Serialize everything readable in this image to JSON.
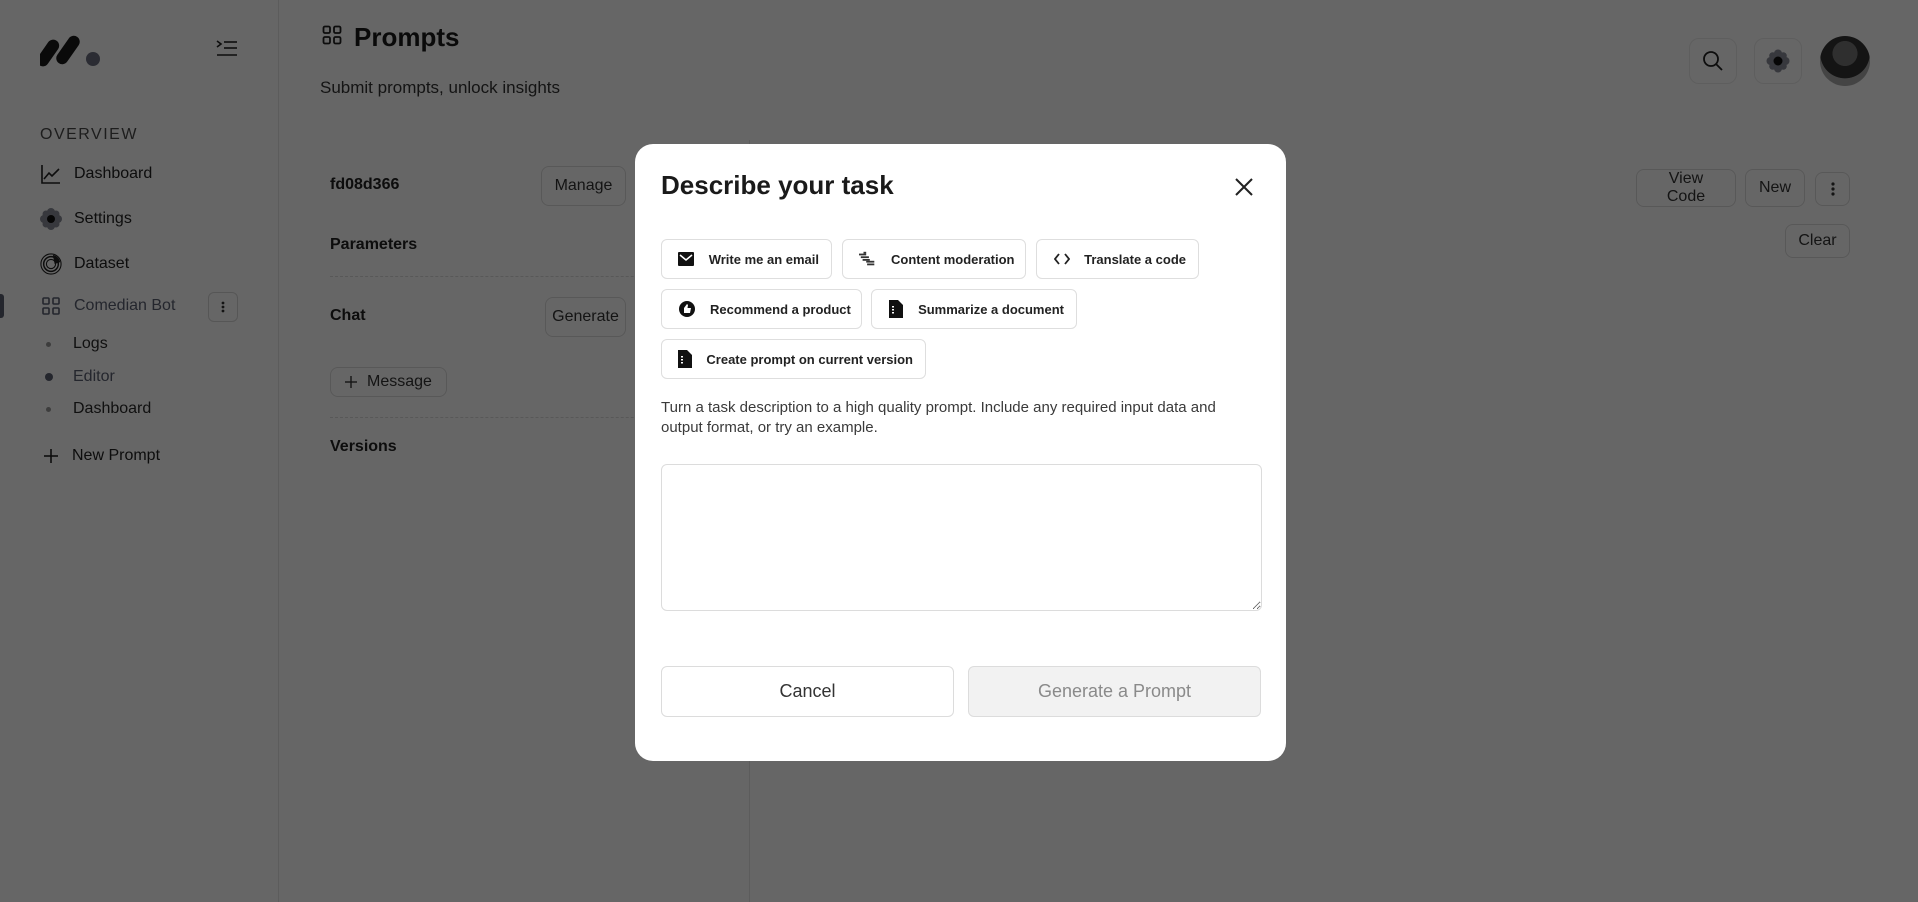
{
  "sidebar": {
    "section_label": "OVERVIEW",
    "items": [
      {
        "label": "Dashboard",
        "icon": "chart-line-icon"
      },
      {
        "label": "Settings",
        "icon": "gear-icon"
      },
      {
        "label": "Dataset",
        "icon": "dataset-icon"
      },
      {
        "label": "Comedian Bot",
        "icon": "grid-icon"
      }
    ],
    "sub_items": [
      {
        "label": "Logs"
      },
      {
        "label": "Editor",
        "active": true
      },
      {
        "label": "Dashboard"
      }
    ],
    "new_prompt_label": "New Prompt"
  },
  "header": {
    "title": "Prompts",
    "subtitle": "Submit prompts, unlock insights"
  },
  "left_panel": {
    "prompt_id": "fd08d366",
    "manage_label": "Manage",
    "parameters_label": "Parameters",
    "chat_label": "Chat",
    "generate_label": "Generate",
    "message_label": "Message",
    "versions_label": "Versions"
  },
  "right_panel": {
    "view_code_label": "View Code",
    "new_label": "New",
    "clear_label": "Clear"
  },
  "modal": {
    "title": "Describe your task",
    "chips": [
      {
        "label": "Write me an email",
        "icon": "email-icon"
      },
      {
        "label": "Content moderation",
        "icon": "moderation-icon"
      },
      {
        "label": "Translate a code",
        "icon": "code-icon"
      },
      {
        "label": "Recommend a product",
        "icon": "thumbs-up-icon"
      },
      {
        "label": "Summarize a document",
        "icon": "document-icon"
      },
      {
        "label": "Create prompt on current version",
        "icon": "document-icon"
      }
    ],
    "description": "Turn a task description to a high quality prompt. Include any required input data and output format, or try an example.",
    "textarea_value": "",
    "textarea_placeholder": "",
    "cancel_label": "Cancel",
    "generate_label": "Generate a Prompt"
  }
}
